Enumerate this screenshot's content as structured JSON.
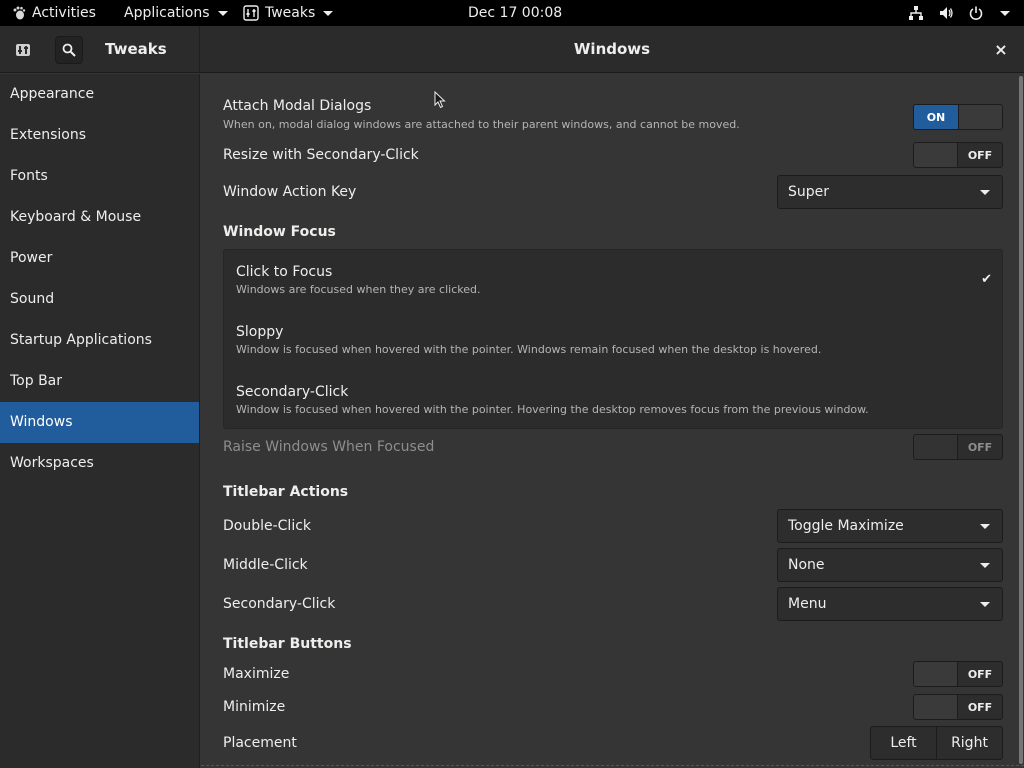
{
  "topbar": {
    "activities": "Activities",
    "applications": "Applications",
    "app_menu": "Tweaks",
    "clock": "Dec 17  00:08"
  },
  "header": {
    "app_title": "Tweaks",
    "page_title": "Windows",
    "close": "×"
  },
  "sidebar": {
    "items": [
      {
        "label": "Appearance"
      },
      {
        "label": "Extensions"
      },
      {
        "label": "Fonts"
      },
      {
        "label": "Keyboard & Mouse"
      },
      {
        "label": "Power"
      },
      {
        "label": "Sound"
      },
      {
        "label": "Startup Applications"
      },
      {
        "label": "Top Bar"
      },
      {
        "label": "Windows"
      },
      {
        "label": "Workspaces"
      }
    ],
    "active_index": 8
  },
  "main": {
    "attach_modal": {
      "label": "Attach Modal Dialogs",
      "desc": "When on, modal dialog windows are attached to their parent windows, and cannot be moved.",
      "state": "ON"
    },
    "resize_secondary": {
      "label": "Resize with Secondary-Click",
      "state": "OFF"
    },
    "action_key": {
      "label": "Window Action Key",
      "value": "Super"
    },
    "window_focus": {
      "title": "Window Focus",
      "items": [
        {
          "title": "Click to Focus",
          "desc": "Windows are focused when they are clicked.",
          "checked": true
        },
        {
          "title": "Sloppy",
          "desc": "Window is focused when hovered with the pointer. Windows remain focused when the desktop is hovered.",
          "checked": false
        },
        {
          "title": "Secondary-Click",
          "desc": "Window is focused when hovered with the pointer. Hovering the desktop removes focus from the previous window.",
          "checked": false
        }
      ],
      "check_glyph": "✔"
    },
    "raise_focused": {
      "label": "Raise Windows When Focused",
      "state": "OFF"
    },
    "titlebar_actions": {
      "title": "Titlebar Actions",
      "double_click": {
        "label": "Double-Click",
        "value": "Toggle Maximize"
      },
      "middle_click": {
        "label": "Middle-Click",
        "value": "None"
      },
      "secondary_click": {
        "label": "Secondary-Click",
        "value": "Menu"
      }
    },
    "titlebar_buttons": {
      "title": "Titlebar Buttons",
      "maximize": {
        "label": "Maximize",
        "state": "OFF"
      },
      "minimize": {
        "label": "Minimize",
        "state": "OFF"
      },
      "placement": {
        "label": "Placement",
        "left": "Left",
        "right": "Right"
      }
    }
  },
  "colors": {
    "accent": "#215d9c",
    "topbar_bg": "#000000",
    "window_bg": "#353535",
    "sidebar_bg": "#2b2b2b"
  }
}
